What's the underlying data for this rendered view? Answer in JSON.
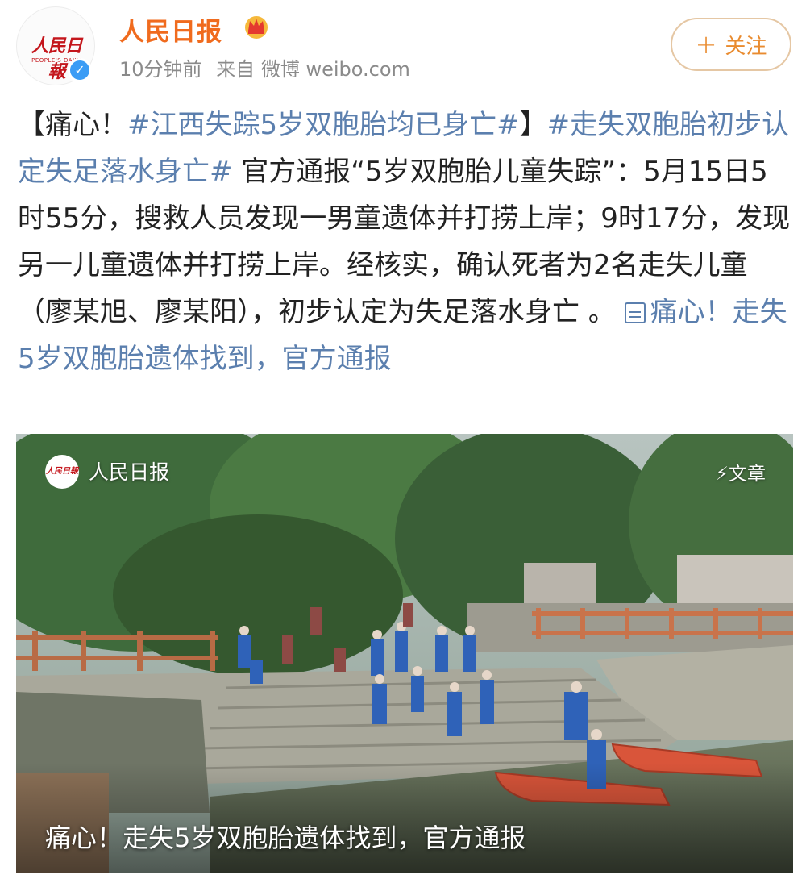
{
  "header": {
    "account_name": "人民日报",
    "avatar_text": "人民日報",
    "avatar_subtext": "PEOPLE'S DAILY",
    "time": "10分钟前",
    "source": "来自 微博 weibo.com",
    "follow_icon": "plus-icon",
    "follow_label": "关注"
  },
  "post": {
    "segments": [
      {
        "type": "text",
        "text": "【痛心！"
      },
      {
        "type": "hashtag",
        "text": "#江西失踪5岁双胞胎均已身亡#"
      },
      {
        "type": "text",
        "text": "】"
      },
      {
        "type": "hashtag",
        "text": "#走失双胞胎初步认定失足落水身亡#"
      },
      {
        "type": "text",
        "text": " 官方通报“5岁双胞胎儿童失踪”：5月15日5时55分，搜救人员发现一男童遗体并打捞上岸；9时17分，发现另一儿童遗体并打捞上岸。经核实，确认死者为2名走失儿童（廖某旭、廖某阳），初步认定为失足落水身亡 。 "
      },
      {
        "type": "link",
        "text": "痛心！走失5岁双胞胎遗体找到，官方通报"
      }
    ]
  },
  "card": {
    "source_logo_text": "人民日報",
    "source": "人民日报",
    "tag": "文章",
    "caption": "痛心！走失5岁双胞胎遗体找到，官方通报"
  },
  "colors": {
    "account_name": "#f06b1e",
    "hashtag": "#5b7fae",
    "follow_border": "#e5c7a4",
    "follow_text": "#e98b2f",
    "verified": "#3b9cf5"
  }
}
